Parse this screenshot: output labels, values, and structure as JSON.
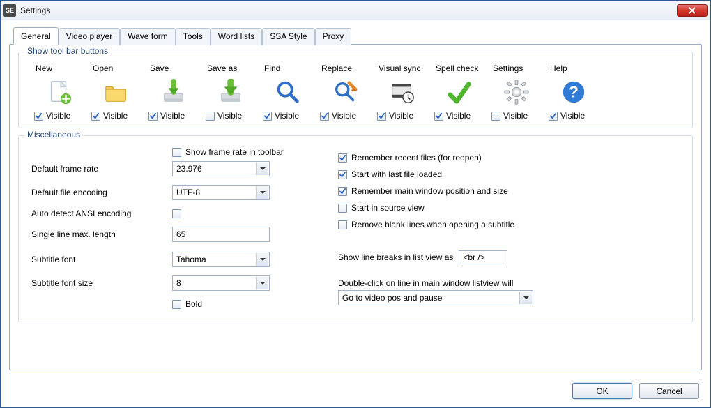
{
  "window": {
    "title": "Settings",
    "app_icon_text": "SE"
  },
  "tabs": [
    {
      "label": "General",
      "active": true
    },
    {
      "label": "Video player",
      "active": false
    },
    {
      "label": "Wave form",
      "active": false
    },
    {
      "label": "Tools",
      "active": false
    },
    {
      "label": "Word lists",
      "active": false
    },
    {
      "label": "SSA Style",
      "active": false
    },
    {
      "label": "Proxy",
      "active": false
    }
  ],
  "toolbar_group": {
    "legend": "Show tool bar buttons",
    "visible_label": "Visible",
    "items": [
      {
        "label": "New",
        "icon": "new-file-icon",
        "checked": true
      },
      {
        "label": "Open",
        "icon": "folder-open-icon",
        "checked": true
      },
      {
        "label": "Save",
        "icon": "save-icon",
        "checked": true
      },
      {
        "label": "Save as",
        "icon": "save-as-icon",
        "checked": false
      },
      {
        "label": "Find",
        "icon": "find-icon",
        "checked": true
      },
      {
        "label": "Replace",
        "icon": "replace-icon",
        "checked": true
      },
      {
        "label": "Visual sync",
        "icon": "visual-sync-icon",
        "checked": true
      },
      {
        "label": "Spell check",
        "icon": "spell-check-icon",
        "checked": true
      },
      {
        "label": "Settings",
        "icon": "gear-icon",
        "checked": false
      },
      {
        "label": "Help",
        "icon": "help-icon",
        "checked": true
      }
    ]
  },
  "misc": {
    "legend": "Miscellaneous",
    "show_frame_rate_label": "Show frame rate in toolbar",
    "show_frame_rate_checked": false,
    "default_frame_rate_label": "Default frame rate",
    "default_frame_rate_value": "23.976",
    "default_encoding_label": "Default file encoding",
    "default_encoding_value": "UTF-8",
    "auto_detect_label": "Auto detect ANSI encoding",
    "auto_detect_checked": false,
    "single_line_label": "Single line max. length",
    "single_line_value": "65",
    "subtitle_font_label": "Subtitle font",
    "subtitle_font_value": "Tahoma",
    "subtitle_font_size_label": "Subtitle font size",
    "subtitle_font_size_value": "8",
    "bold_label": "Bold",
    "bold_checked": false,
    "remember_recent_label": "Remember recent files (for reopen)",
    "remember_recent_checked": true,
    "start_with_last_label": "Start with last file loaded",
    "start_with_last_checked": true,
    "remember_window_label": "Remember main window position and size",
    "remember_window_checked": true,
    "start_source_label": "Start in source view",
    "start_source_checked": false,
    "remove_blank_label": "Remove blank lines when opening a subtitle",
    "remove_blank_checked": false,
    "line_breaks_label": "Show line breaks in list view as",
    "line_breaks_value": "<br />",
    "double_click_label": "Double-click on line in main window listview will",
    "double_click_value": "Go to video pos and pause"
  },
  "buttons": {
    "ok": "OK",
    "cancel": "Cancel"
  }
}
